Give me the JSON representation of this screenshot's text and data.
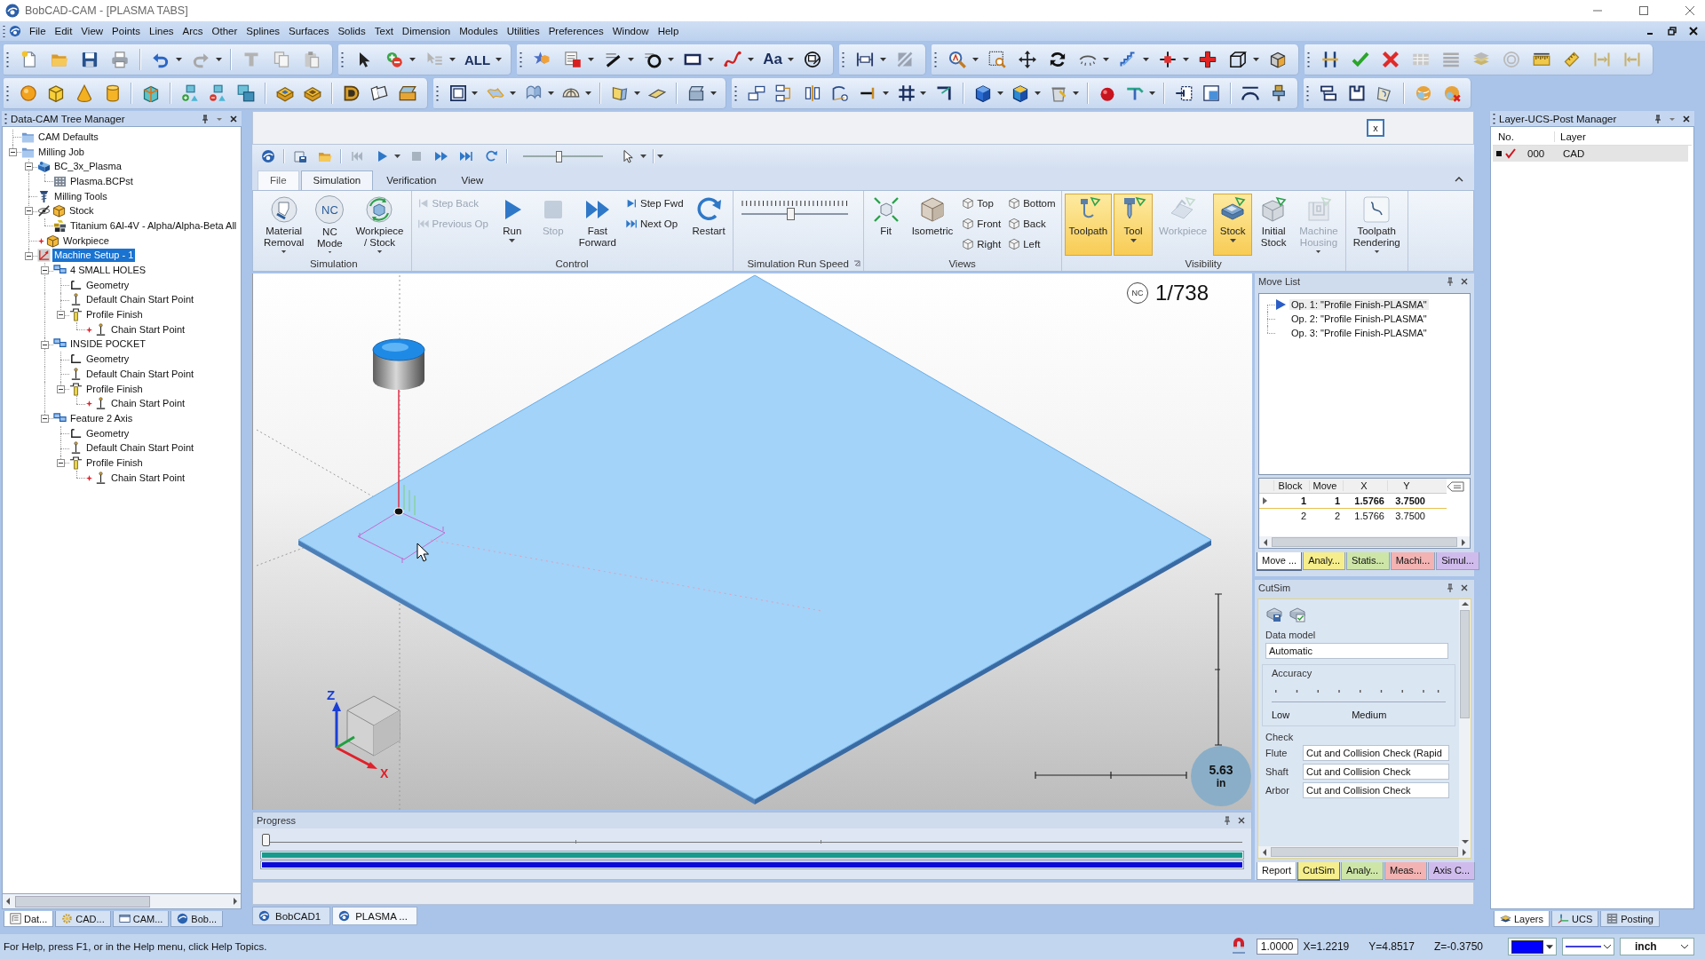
{
  "window": {
    "title": "BobCAD-CAM - [PLASMA TABS]"
  },
  "menu": [
    "File",
    "Edit",
    "View",
    "Points",
    "Lines",
    "Arcs",
    "Other",
    "Splines",
    "Surfaces",
    "Solids",
    "Text",
    "Dimension",
    "Modules",
    "Utilities",
    "Preferences",
    "Window",
    "Help"
  ],
  "toolbar": {
    "selection_filter": "ALL",
    "text_tool": "Aa"
  },
  "tree_panel": {
    "title": "Data-CAM Tree Manager",
    "items": [
      {
        "label": "CAM Defaults",
        "kind": "folder",
        "selected": false,
        "flagged": false
      },
      {
        "label": "Milling Job",
        "kind": "folder",
        "selected": false,
        "flagged": false,
        "expanded": true,
        "children": [
          {
            "label": "BC_3x_Plasma",
            "kind": "machine",
            "selected": false,
            "flagged": false,
            "expanded": true,
            "children": [
              {
                "label": "Plasma.BCPst",
                "kind": "post",
                "selected": false,
                "flagged": false
              }
            ]
          },
          {
            "label": "Milling Tools",
            "kind": "tools",
            "selected": false,
            "flagged": false
          },
          {
            "label": "Stock",
            "kind": "stock",
            "selected": false,
            "flagged": false,
            "expanded": true,
            "children": [
              {
                "label": "Titanium 6Al-4V - Alpha/Alpha-Beta All",
                "kind": "material",
                "selected": false,
                "flagged": false
              }
            ]
          },
          {
            "label": "Workpiece",
            "kind": "workpiece",
            "selected": false,
            "flagged": true
          },
          {
            "label": "Machine Setup - 1",
            "kind": "setup",
            "selected": true,
            "flagged": false,
            "expanded": true,
            "children": [
              {
                "label": "4 SMALL HOLES",
                "kind": "feature",
                "selected": false,
                "flagged": false,
                "expanded": true,
                "children": [
                  {
                    "label": "Geometry",
                    "kind": "geometry",
                    "selected": false,
                    "flagged": false
                  },
                  {
                    "label": "Default Chain Start Point",
                    "kind": "chain-start",
                    "selected": false,
                    "flagged": false
                  },
                  {
                    "label": "Profile Finish",
                    "kind": "operation",
                    "selected": false,
                    "flagged": false,
                    "expanded": true,
                    "children": [
                      {
                        "label": "Chain Start Point",
                        "kind": "chain-start",
                        "selected": false,
                        "flagged": true
                      }
                    ]
                  }
                ]
              },
              {
                "label": "INSIDE POCKET",
                "kind": "feature",
                "selected": false,
                "flagged": false,
                "expanded": true,
                "children": [
                  {
                    "label": "Geometry",
                    "kind": "geometry",
                    "selected": false,
                    "flagged": false
                  },
                  {
                    "label": "Default Chain Start Point",
                    "kind": "chain-start",
                    "selected": false,
                    "flagged": false
                  },
                  {
                    "label": "Profile Finish",
                    "kind": "operation",
                    "selected": false,
                    "flagged": false,
                    "expanded": true,
                    "children": [
                      {
                        "label": "Chain Start Point",
                        "kind": "chain-start",
                        "selected": false,
                        "flagged": true
                      }
                    ]
                  }
                ]
              },
              {
                "label": "Feature 2 Axis",
                "kind": "feature",
                "selected": false,
                "flagged": false,
                "expanded": true,
                "children": [
                  {
                    "label": "Geometry",
                    "kind": "geometry",
                    "selected": false,
                    "flagged": false
                  },
                  {
                    "label": "Default Chain Start Point",
                    "kind": "chain-start",
                    "selected": false,
                    "flagged": false
                  },
                  {
                    "label": "Profile Finish",
                    "kind": "operation",
                    "selected": false,
                    "flagged": false,
                    "expanded": true,
                    "children": [
                      {
                        "label": "Chain Start Point",
                        "kind": "chain-start",
                        "selected": false,
                        "flagged": true
                      }
                    ]
                  }
                ]
              }
            ]
          }
        ]
      }
    ],
    "tabs": [
      {
        "label": "Dat...",
        "selected": true
      },
      {
        "label": "CAD...",
        "selected": false
      },
      {
        "label": "CAM...",
        "selected": false
      },
      {
        "label": "Bob...",
        "selected": false
      }
    ]
  },
  "close_button": "x",
  "quick_access": {
    "slider": {
      "level": 0.44
    }
  },
  "ribbon": {
    "tabs": [
      {
        "label": "File",
        "kind": "menu",
        "selected": false
      },
      {
        "label": "Simulation",
        "kind": "tab",
        "selected": true
      },
      {
        "label": "Verification",
        "kind": "tab",
        "selected": false
      },
      {
        "label": "View",
        "kind": "tab",
        "selected": false
      }
    ],
    "groups": [
      {
        "label": "Simulation",
        "launcher": false,
        "items": [
          {
            "kind": "large",
            "label": "Material\nRemoval",
            "disabled": false,
            "dropdown": true
          },
          {
            "kind": "large",
            "label": "NC\nMode",
            "badge": "NC",
            "disabled": false,
            "dropdown": true
          },
          {
            "kind": "large",
            "label": "Workpiece\n/ Stock",
            "disabled": false,
            "dropdown": true
          }
        ]
      },
      {
        "label": "Control",
        "launcher": false,
        "items": [
          {
            "kind": "small",
            "label": "Step Back",
            "disabled": true
          },
          {
            "kind": "small",
            "label": "Previous Op",
            "disabled": true
          },
          {
            "kind": "large",
            "label": "Run",
            "disabled": false,
            "dropdown": true
          },
          {
            "kind": "large",
            "label": "Stop",
            "disabled": true,
            "dropdown": false
          },
          {
            "kind": "large",
            "label": "Fast\nForward",
            "disabled": false,
            "dropdown": false
          },
          {
            "kind": "small",
            "label": "Step Fwd",
            "disabled": false
          },
          {
            "kind": "small",
            "label": "Next Op",
            "disabled": false
          },
          {
            "kind": "large",
            "label": "Restart",
            "disabled": false,
            "dropdown": false
          }
        ]
      },
      {
        "label": "Simulation Run Speed",
        "launcher": true,
        "items": [
          {
            "kind": "slider",
            "level": 0.46
          }
        ]
      },
      {
        "label": "Views",
        "launcher": false,
        "items": [
          {
            "kind": "large",
            "label": "Fit",
            "disabled": false,
            "dropdown": false
          },
          {
            "kind": "large",
            "label": "Isometric",
            "disabled": false,
            "dropdown": false
          },
          {
            "kind": "small",
            "label": "Top",
            "disabled": false
          },
          {
            "kind": "small",
            "label": "Front",
            "disabled": false
          },
          {
            "kind": "small",
            "label": "Right",
            "disabled": false
          },
          {
            "kind": "small",
            "label": "Bottom",
            "disabled": false
          },
          {
            "kind": "small",
            "label": "Back",
            "disabled": false
          },
          {
            "kind": "small",
            "label": "Left",
            "disabled": false
          }
        ]
      },
      {
        "label": "Visibility",
        "launcher": false,
        "items": [
          {
            "kind": "toggle",
            "label": "Toolpath",
            "on": true,
            "disabled": false,
            "dropdown": false
          },
          {
            "kind": "toggle",
            "label": "Tool",
            "on": true,
            "disabled": false,
            "dropdown": true
          },
          {
            "kind": "toggle",
            "label": "Workpiece",
            "on": false,
            "disabled": true,
            "dropdown": false
          },
          {
            "kind": "toggle",
            "label": "Stock",
            "on": true,
            "disabled": false,
            "dropdown": true
          },
          {
            "kind": "toggle",
            "label": "Initial\nStock",
            "on": false,
            "disabled": false,
            "dropdown": false
          },
          {
            "kind": "toggle",
            "label": "Machine\nHousing",
            "on": false,
            "disabled": true,
            "dropdown": true
          }
        ]
      },
      {
        "items": [
          {
            "kind": "large",
            "label": "Toolpath\nRendering",
            "disabled": false,
            "dropdown": true
          }
        ]
      }
    ]
  },
  "viewport": {
    "nc_badge": "NC",
    "counter": "1/738",
    "axes": {
      "z": "Z",
      "x": "X"
    },
    "scale": {
      "value": "5.63",
      "unit": "in"
    }
  },
  "progress": {
    "title": "Progress",
    "level": 0,
    "bars": [
      {
        "color": "#179a8c",
        "level": 1
      },
      {
        "color": "#0a0ad8",
        "level": 1
      }
    ]
  },
  "move_list": {
    "title": "Move List",
    "operations": [
      {
        "label": "Op. 1: \"Profile Finish-PLASMA\"",
        "current": true
      },
      {
        "label": "Op. 2: \"Profile Finish-PLASMA\"",
        "current": false
      },
      {
        "label": "Op. 3: \"Profile Finish-PLASMA\"",
        "current": false
      }
    ],
    "grid": {
      "columns": [
        "Block",
        "Move",
        "X",
        "Y"
      ],
      "rows": [
        {
          "cells": [
            "1",
            "1",
            "1.5766",
            "3.7500"
          ],
          "current": true
        },
        {
          "cells": [
            "2",
            "2",
            "1.5766",
            "3.7500"
          ],
          "current": false
        }
      ]
    },
    "tabs": [
      {
        "label": "Move ...",
        "color": "#ffffff",
        "selected": true
      },
      {
        "label": "Analy...",
        "color": "#f6ee8c",
        "selected": false
      },
      {
        "label": "Statis...",
        "color": "#cde6a8",
        "selected": false
      },
      {
        "label": "Machi...",
        "color": "#f3b3b3",
        "selected": false
      },
      {
        "label": "Simul...",
        "color": "#d0bcec",
        "selected": false
      }
    ]
  },
  "cutsim": {
    "title": "CutSim",
    "data_model_label": "Data model",
    "data_model": "Automatic",
    "accuracy_label": "Accuracy",
    "accuracy_marks": [
      "Low",
      "Medium"
    ],
    "check_label": "Check",
    "checks": [
      {
        "label": "Flute",
        "value": "Cut and Collision Check (Rapid"
      },
      {
        "label": "Shaft",
        "value": "Cut and Collision Check"
      },
      {
        "label": "Arbor",
        "value": "Cut and Collision Check"
      }
    ],
    "tabs": [
      {
        "label": "Report",
        "color": "#ffffff",
        "selected": false
      },
      {
        "label": "CutSim",
        "color": "#f6ee8c",
        "selected": true
      },
      {
        "label": "Analy...",
        "color": "#cde6a8",
        "selected": false
      },
      {
        "label": "Meas...",
        "color": "#f3b3b3",
        "selected": false
      },
      {
        "label": "Axis C...",
        "color": "#d0bcec",
        "selected": false
      }
    ]
  },
  "layer_panel": {
    "title": "Layer-UCS-Post Manager",
    "columns": [
      "No.",
      "Layer"
    ],
    "rows": [
      {
        "current": true,
        "on": true,
        "number": "000",
        "name": "CAD"
      }
    ],
    "tabs": [
      {
        "label": "Layers",
        "selected": true
      },
      {
        "label": "UCS",
        "selected": false
      },
      {
        "label": "Posting",
        "selected": false
      }
    ]
  },
  "documents": [
    {
      "label": "BobCAD1",
      "selected": false
    },
    {
      "label": "PLASMA ...",
      "selected": true
    }
  ],
  "status": {
    "help": "For Help, press F1, or in the Help menu, click Help Topics.",
    "scale": "1.0000",
    "x": "X=1.2219",
    "y": "Y=4.8517",
    "z": "Z=-0.3750",
    "color": "#0000ff",
    "unit": "inch"
  }
}
